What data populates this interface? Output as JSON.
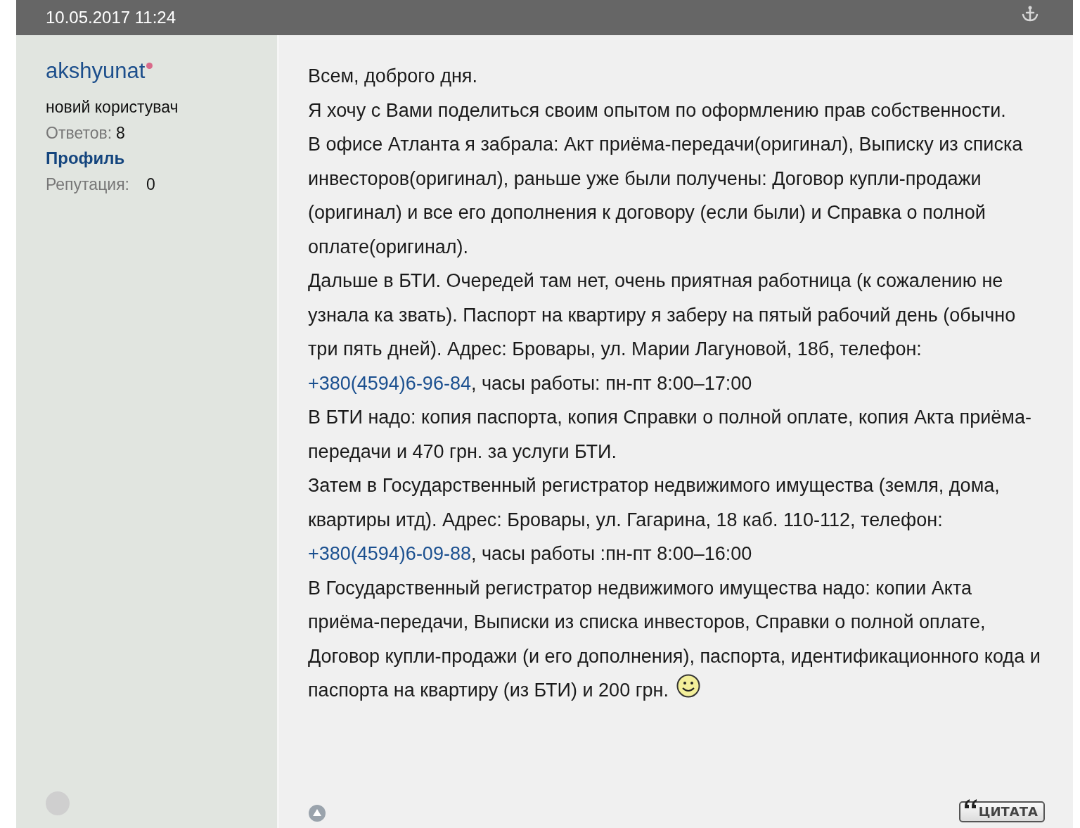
{
  "post": {
    "date": "10.05.2017 11:24",
    "author": {
      "username": "akshyunat",
      "rank": "новий користувач",
      "replies_label": "Ответов:",
      "replies": "8",
      "profile_link": "Профиль",
      "reputation_label": "Репутация:",
      "reputation": "0"
    },
    "paragraphs": [
      [
        {
          "kind": "text",
          "text": "Всем, доброго дня."
        }
      ],
      [
        {
          "kind": "text",
          "text": "Я хочу с Вами поделиться своим опытом по оформлению прав собственности."
        }
      ],
      [
        {
          "kind": "text",
          "text": "В офисе Атланта я забрала: Акт приёма-передачи(оригинал), Выписку из списка инвесторов(оригинал), раньше уже были получены: Договор купли-продажи (оригинал) и все его дополнения к договору (если были) и Справка о полной оплате(оригинал)."
        }
      ],
      [
        {
          "kind": "text",
          "text": "Дальше в БТИ. Очередей там нет, очень приятная работница (к сожалению не узнала ка звать). Паспорт на квартиру я заберу на пятый рабочий день (обычно три пять дней). Адрес: Бровары, ул. Марии Лагуновой, 18б, телефон: "
        },
        {
          "kind": "link",
          "text": "+380(4594)6-96-84"
        },
        {
          "kind": "text",
          "text": ", часы работы: пн-пт 8:00–17:00"
        }
      ],
      [
        {
          "kind": "text",
          "text": "В БТИ надо: копия паспорта, копия Справки о полной оплате, копия Акта приёма-передачи и 470 грн. за услуги БТИ."
        }
      ],
      [
        {
          "kind": "text",
          "text": "Затем в Государственный регистратор недвижимого имущества (земля, дома, квартиры итд). Адрес: Бровары, ул. Гагарина, 18 каб. 110-112, телефон: "
        },
        {
          "kind": "link",
          "text": "+380(4594)6-09-88"
        },
        {
          "kind": "text",
          "text": ", часы работы :пн-пт 8:00–16:00"
        }
      ],
      [
        {
          "kind": "text",
          "text": "В Государственный регистратор недвижимого имущества надо: копии Акта приёма-передачи, Выписки из списка инвесторов, Справки о полной оплате, Договор купли-продажи (и его дополнения), паспорта, идентификационного кода и паспорта на квартиру (из БТИ) и 200 грн. "
        },
        {
          "kind": "smiley"
        }
      ]
    ],
    "quote_button": "ЦИТАТА"
  }
}
